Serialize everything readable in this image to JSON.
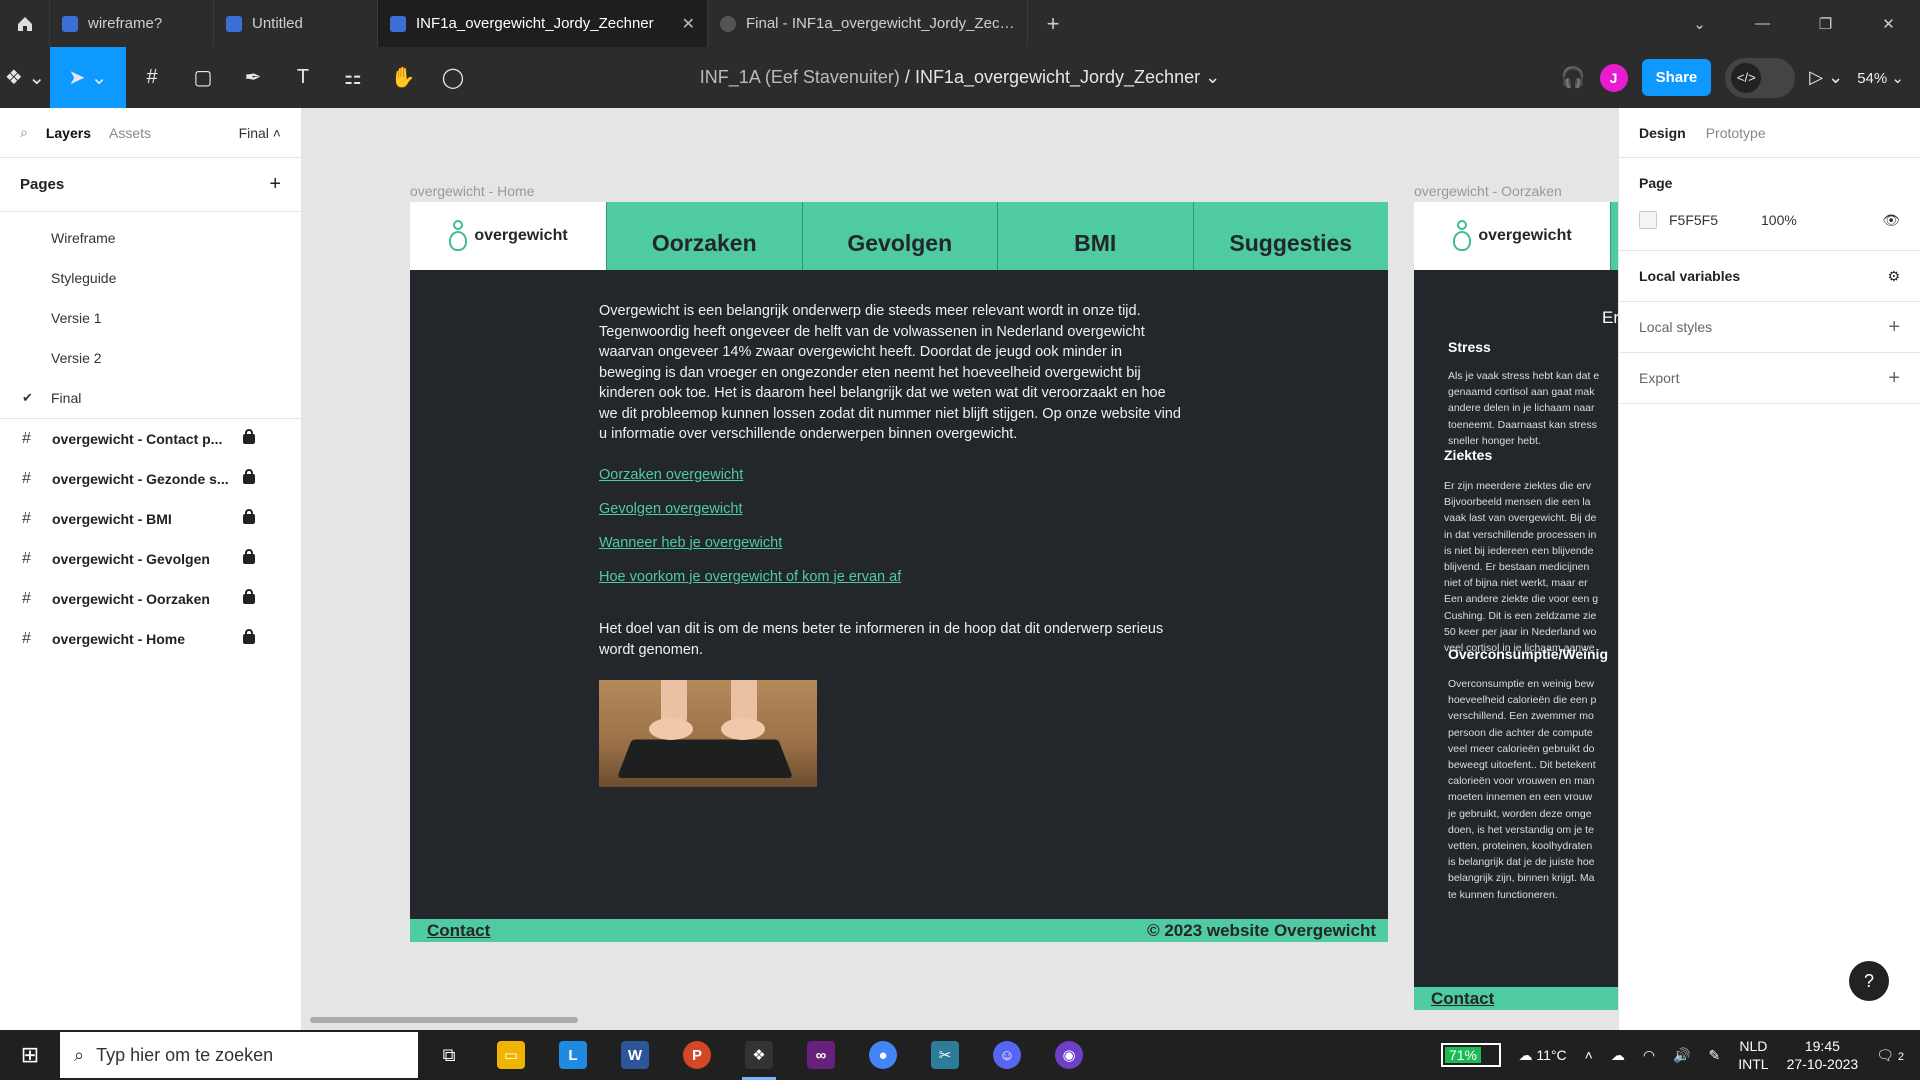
{
  "tabs": [
    {
      "label": "wireframe?",
      "active": false
    },
    {
      "label": "Untitled",
      "active": false
    },
    {
      "label": "INF1a_overgewicht_Jordy_Zechner",
      "active": true
    },
    {
      "label": "Final - INF1a_overgewicht_Jordy_Zechner",
      "active": false
    }
  ],
  "toolbar": {
    "project": "INF_1A (Eef Stavenuiter)",
    "separator": "/",
    "file": "INF1a_overgewicht_Jordy_Zechner",
    "avatar_initial": "J",
    "share_label": "Share",
    "zoom": "54%"
  },
  "leftpanel": {
    "tab_layers": "Layers",
    "tab_assets": "Assets",
    "page_selector": "Final",
    "pages_title": "Pages",
    "pages": [
      "Wireframe",
      "Styleguide",
      "Versie 1",
      "Versie 2",
      "Final"
    ],
    "current_page": "Final",
    "frames": [
      "overgewicht - Contact p...",
      "overgewicht - Gezonde s...",
      "overgewicht - BMI",
      "overgewicht - Gevolgen",
      "overgewicht - Oorzaken",
      "overgewicht - Home"
    ]
  },
  "canvas": {
    "home": {
      "label": "overgewicht - Home",
      "logo_text": "overgewicht",
      "nav": [
        "Oorzaken",
        "Gevolgen",
        "BMI",
        "Suggesties"
      ],
      "intro": "Overgewicht is een belangrijk onderwerp die steeds meer relevant wordt in onze tijd. Tegenwoordig heeft ongeveer de helft van de volwassenen in Nederland overgewicht waarvan ongeveer 14% zwaar overgewicht heeft. Doordat de jeugd ook minder in beweging is dan vroeger en ongezonder eten neemt het hoeveelheid overgewicht bij kinderen ook toe. Het is daarom heel belangrijk dat we weten wat dit veroorzaakt en hoe we dit probleemop kunnen lossen zodat dit nummer niet blijft stijgen. Op onze website vind u informatie over verschillende onderwerpen binnen overgewicht.",
      "links": [
        "Oorzaken overgewicht",
        "Gevolgen overgewicht",
        "Wanneer heb je overgewicht",
        "Hoe voorkom je overgewicht of kom je ervan af"
      ],
      "outro": "Het doel van dit is om de mens beter te informeren in de hoop dat dit onderwerp serieus wordt genomen.",
      "footer_contact": "Contact",
      "footer_copy": "© 2023 website Overgewicht"
    },
    "oorzaken": {
      "label": "overgewicht - Oorzaken",
      "logo_text": "overgewicht",
      "heading_partial": "Er",
      "h_stress": "Stress",
      "stress_text": "Als je vaak stress hebt kan dat e\ngenaamd cortisol aan gaat mak\nandere delen in je lichaam naar\ntoeneemt. Daarnaast kan stress\nsneller honger hebt.",
      "h_ziektes": "Ziektes",
      "ziektes_text": "Er zijn meerdere ziektes die erv\nBijvoorbeeld mensen die een la\nvaak last van overgewicht. Bij de\nin dat verschillende processen in\nis niet bij iedereen een blijvende\nblijvend. Er bestaan medicijnen\nniet of bijna niet werkt, maar er\nEen andere ziekte die voor een g\nCushing. Dit is een zeldzame zie\n50 keer per jaar in Nederland wo\nveel cortisol in je lichaam aanwe",
      "h_over": "Overconsumptie/Weinig",
      "over_text": "Overconsumptie en weinig bew\nhoeveelheid calorieën die een p\nverschillend. Een zwemmer mo\npersoon die achter de compute\nveel meer calorieën gebruikt do\nbeweegt uitoefent.. Dit betekent\ncalorieën voor vrouwen en man\nmoeten innemen en een vrouw\nje gebruikt, worden deze omge\ndoen, is het verstandig om je te\nvetten, proteinen, koolhydraten\nis belangrijk dat je de juiste hoe\nbelangrijk zijn, binnen krijgt. Ma\nte kunnen functioneren.",
      "footer_contact": "Contact"
    }
  },
  "rightpanel": {
    "tab_design": "Design",
    "tab_prototype": "Prototype",
    "page_title": "Page",
    "page_color": "F5F5F5",
    "page_opacity": "100%",
    "local_variables": "Local variables",
    "local_styles": "Local styles",
    "export": "Export",
    "help": "?"
  },
  "taskbar": {
    "search_placeholder": "Typ hier om te zoeken",
    "battery": "71%",
    "weather": "11°C",
    "lang1": "NLD",
    "lang2": "INTL",
    "time": "19:45",
    "date": "27-10-2023",
    "notif_count": "2"
  },
  "colors": {
    "accent": "#0d99ff",
    "site_green": "#4ecba0",
    "site_dark": "#23262b"
  }
}
